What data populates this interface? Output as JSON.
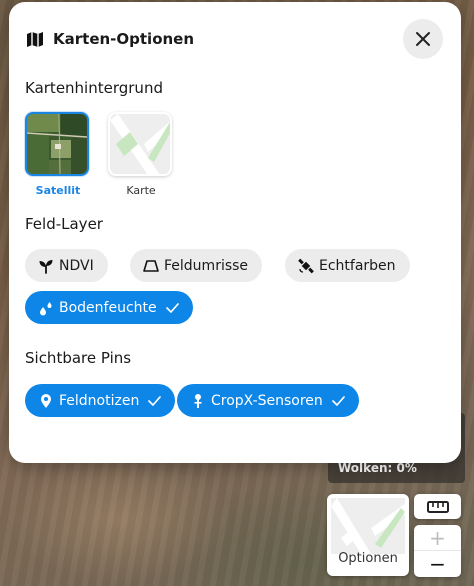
{
  "map_background": {
    "weather_text": "Wolken: 0%"
  },
  "map_controls": {
    "options_label": "Optionen",
    "ruler_icon": "ruler-icon",
    "zoom_in_label": "+",
    "zoom_out_label": "−"
  },
  "modal": {
    "title": "Karten-Optionen",
    "title_icon": "map-icon",
    "close_icon": "close-icon",
    "basemap": {
      "heading": "Kartenhintergrund",
      "options": [
        {
          "label": "Satellit",
          "selected": true,
          "icon": "satellite-thumbnail"
        },
        {
          "label": "Karte",
          "selected": false,
          "icon": "map-thumbnail"
        }
      ]
    },
    "field_layers": {
      "heading": "Feld-Layer",
      "chips": [
        {
          "label": "NDVI",
          "icon": "sprout-icon",
          "active": false
        },
        {
          "label": "Feldumrisse",
          "icon": "field-outline-icon",
          "active": false
        },
        {
          "label": "Echtfarben",
          "icon": "satellite-icon",
          "active": false
        },
        {
          "label": "Bodenfeuchte",
          "icon": "droplets-icon",
          "active": true
        }
      ]
    },
    "visible_pins": {
      "heading": "Sichtbare Pins",
      "chips": [
        {
          "label": "Feldnotizen",
          "icon": "map-pin-icon",
          "active": true
        },
        {
          "label": "CropX-Sensoren",
          "icon": "sensor-icon",
          "active": true
        }
      ]
    }
  },
  "colors": {
    "accent": "#0d86e8",
    "chip_inactive": "#ececec",
    "text": "#1a1a1a"
  }
}
